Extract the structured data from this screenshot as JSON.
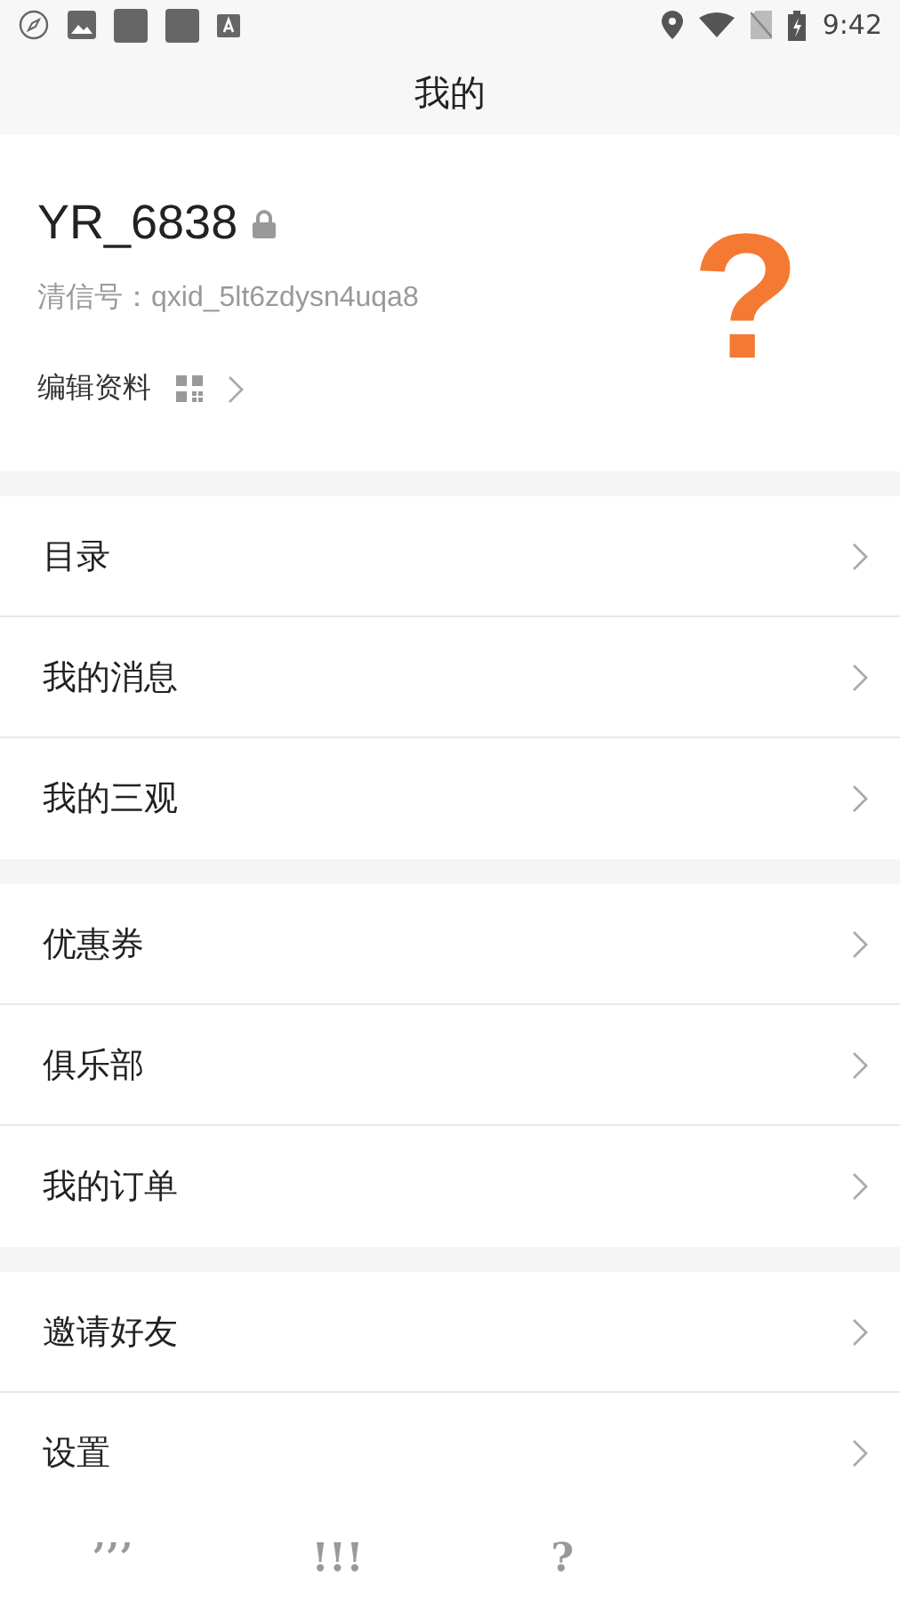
{
  "status_bar": {
    "time": "9:42"
  },
  "header": {
    "title": "我的"
  },
  "profile": {
    "username": "YR_6838",
    "id_label": "清信号：qxid_5lt6zdysn4uqa8",
    "edit_label": "编辑资料",
    "avatar": "?"
  },
  "menu_groups": [
    [
      {
        "label": "目录"
      },
      {
        "label": "我的消息"
      },
      {
        "label": "我的三观"
      }
    ],
    [
      {
        "label": "优惠券"
      },
      {
        "label": "俱乐部"
      },
      {
        "label": "我的订单"
      }
    ],
    [
      {
        "label": "邀请好友"
      },
      {
        "label": "设置"
      }
    ]
  ],
  "bottom_nav": [
    {
      "label": "’’’"
    },
    {
      "label": "!!!"
    },
    {
      "label": "?"
    }
  ]
}
